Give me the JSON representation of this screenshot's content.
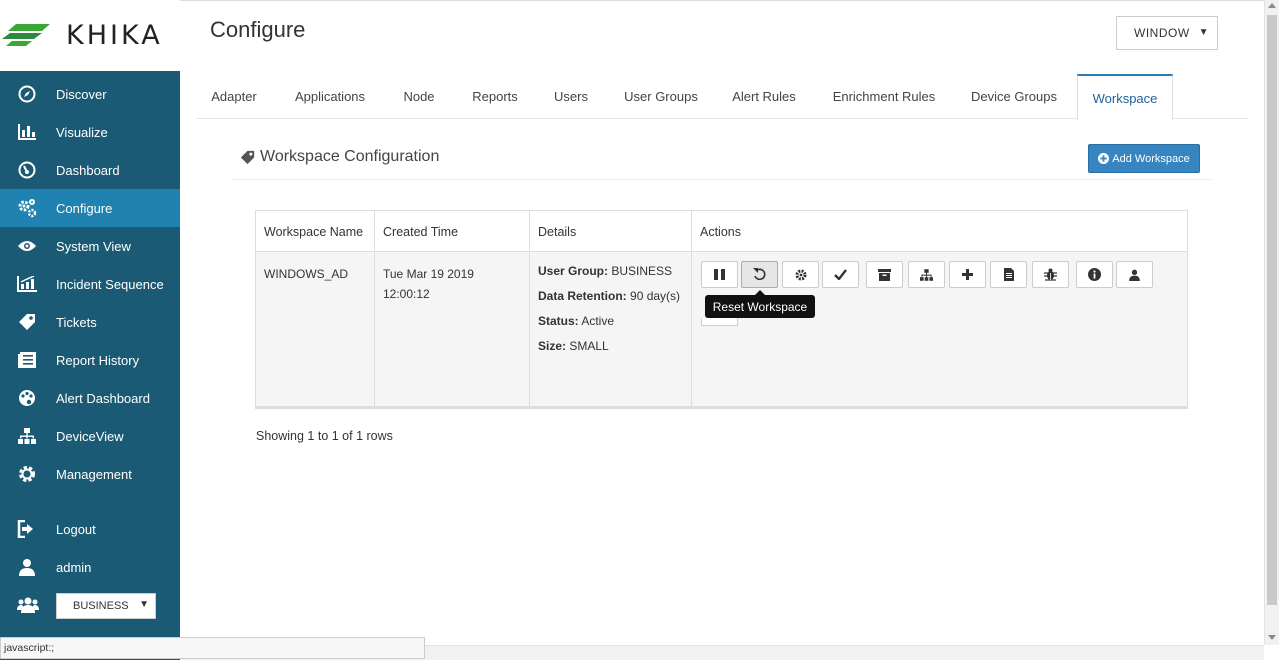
{
  "brand": {
    "name": "KHIKA",
    "colors": {
      "primary_green": "#3aa635",
      "sidebar": "#1b5a75",
      "sidebar_active": "#1f82b0",
      "accent_blue": "#3785c0"
    }
  },
  "header": {
    "title": "Configure",
    "workspace_select": "WINDOW"
  },
  "sidebar": {
    "items": [
      {
        "label": "Discover",
        "icon": "compass-icon"
      },
      {
        "label": "Visualize",
        "icon": "bar-chart-icon"
      },
      {
        "label": "Dashboard",
        "icon": "dashboard-icon"
      },
      {
        "label": "Configure",
        "icon": "cogs-icon",
        "active": true
      },
      {
        "label": "System View",
        "icon": "eye-icon"
      },
      {
        "label": "Incident Sequence",
        "icon": "sequence-icon"
      },
      {
        "label": "Tickets",
        "icon": "tag-icon"
      },
      {
        "label": "Report History",
        "icon": "list-icon"
      },
      {
        "label": "Alert Dashboard",
        "icon": "palette-icon"
      },
      {
        "label": "DeviceView",
        "icon": "sitemap-icon"
      },
      {
        "label": "Management",
        "icon": "gear-icon"
      }
    ],
    "bottom": [
      {
        "label": "Logout",
        "icon": "sign-out-icon"
      },
      {
        "label": "admin",
        "icon": "user-icon"
      }
    ],
    "group_select": "BUSINESS"
  },
  "tabs": [
    {
      "label": "Adapter"
    },
    {
      "label": "Applications"
    },
    {
      "label": "Node"
    },
    {
      "label": "Reports"
    },
    {
      "label": "Users"
    },
    {
      "label": "User Groups"
    },
    {
      "label": "Alert Rules"
    },
    {
      "label": "Enrichment Rules"
    },
    {
      "label": "Device Groups"
    },
    {
      "label": "Workspace",
      "active": true
    }
  ],
  "section": {
    "title": "Workspace Configuration",
    "add_button": "Add Workspace"
  },
  "table": {
    "columns": [
      "Workspace Name",
      "Created Time",
      "Details",
      "Actions"
    ],
    "rows": [
      {
        "name": "WINDOWS_AD",
        "created_line1": "Tue Mar 19 2019",
        "created_line2": "12:00:12",
        "details": {
          "user_group_label": "User Group:",
          "user_group": "BUSINESS",
          "retention_label": "Data Retention:",
          "retention": "90 day(s)",
          "status_label": "Status:",
          "status": "Active",
          "size_label": "Size:",
          "size": "SMALL"
        }
      }
    ],
    "actions": [
      "pause-icon",
      "reset-icon",
      "gear-icon",
      "check-icon",
      "archive-icon",
      "sitemap-icon",
      "plus-icon",
      "file-icon",
      "bug-icon",
      "info-icon",
      "user-icon"
    ],
    "tooltip": "Reset Workspace"
  },
  "pagination": {
    "info": "Showing 1 to 1 of 1 rows"
  },
  "status_bar": {
    "text": "javascript:;"
  }
}
